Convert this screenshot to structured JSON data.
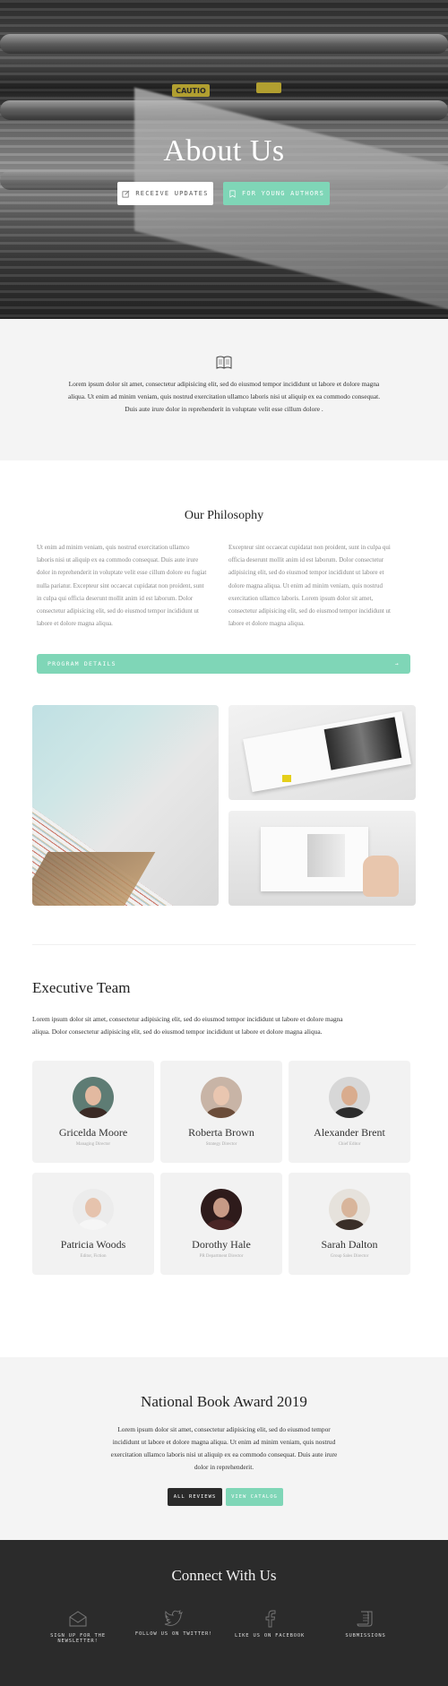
{
  "hero": {
    "title": "About Us",
    "btn_receive": "RECEIVE UPDATES",
    "btn_young": "FOR YOUNG AUTHORS",
    "sign_text": "CAUTIO"
  },
  "intro": {
    "text": "Lorem ipsum dolor sit amet, consectetur adipisicing elit, sed do eiusmod tempor incididunt ut labore et dolore magna aliqua. Ut enim ad minim veniam, quis nostrud exercitation ullamco laboris nisi ut aliquip ex ea commodo consequat. Duis aute irure dolor in reprehenderit in voluptate velit esse cillum dolore ."
  },
  "philosophy": {
    "title": "Our Philosophy",
    "left": "Ut enim ad minim veniam, quis nostrud exercitation ullamco laboris nisi ut aliquip ex ea commodo consequat. Duis aute irure dolor in reprehenderit in voluptate velit esse cillum dolore eu fugiat nulla pariatur. Excepteur sint occaecat cupidatat non proident, sunt in culpa qui officia deserunt mollit anim id est laborum. Dolor consectetur adipisicing elit, sed do eiusmod tempor incididunt ut labore et dolore magna aliqua.",
    "right": "Excepteur sint occaecat cupidatat non proident, sunt in culpa qui officia deserunt mollit anim id est laborum. Dolor consectetur adipisicing elit, sed do eiusmod tempor incididunt ut labore et dolore magna aliqua. Ut enim ad minim veniam, quis nostrud exercitation ullamco laboris. Lorem ipsum dolor sit amet, consectetur adipisicing elit, sed do eiusmod tempor incididunt ut labore et dolore magna aliqua.",
    "button": "PROGRAM DETAILS",
    "button_arrow": "→"
  },
  "team": {
    "title": "Executive Team",
    "lead": "Lorem ipsum dolor sit amet, consectetur adipisicing elit, sed do eiusmod tempor incididunt ut labore et dolore magna aliqua. Dolor consectetur adipisicing elit, sed do eiusmod tempor incididunt ut labore et dolore magna aliqua.",
    "members": [
      {
        "name": "Gricelda Moore",
        "role": "Managing Director"
      },
      {
        "name": "Roberta Brown",
        "role": "Strategy Director"
      },
      {
        "name": "Alexander Brent",
        "role": "Chief Editor"
      },
      {
        "name": "Patricia Woods",
        "role": "Editor, Fiction"
      },
      {
        "name": "Dorothy Hale",
        "role": "PR Department Director"
      },
      {
        "name": "Sarah Dalton",
        "role": "Group Sales Director"
      }
    ]
  },
  "award": {
    "title": "National Book Award 2019",
    "text": "Lorem ipsum dolor sit amet, consectetur adipisicing elit, sed do eiusmod tempor incididunt ut labore et dolore magna aliqua. Ut enim ad minim veniam, quis nostrud exercitation ullamco laboris nisi ut aliquip ex ea commodo consequat. Duis aute irure dolor in reprehenderit.",
    "btn_reviews": "ALL REVIEWS",
    "btn_catalog": "VIEW CATALOG"
  },
  "connect": {
    "title": "Connect With Us",
    "links": [
      {
        "label": "SIGN UP FOR THE NEWSLETTER!",
        "icon": "mail-icon"
      },
      {
        "label": "FOLLOW US ON TWITTER!",
        "icon": "twitter-icon"
      },
      {
        "label": "LIKE US ON FACEBOOK",
        "icon": "facebook-icon"
      },
      {
        "label": "SUBMISSIONS",
        "icon": "scroll-icon"
      }
    ]
  },
  "colors": {
    "accent": "#7fd6b7",
    "dark": "#2b2b2b",
    "light_bg": "#f4f4f4"
  }
}
